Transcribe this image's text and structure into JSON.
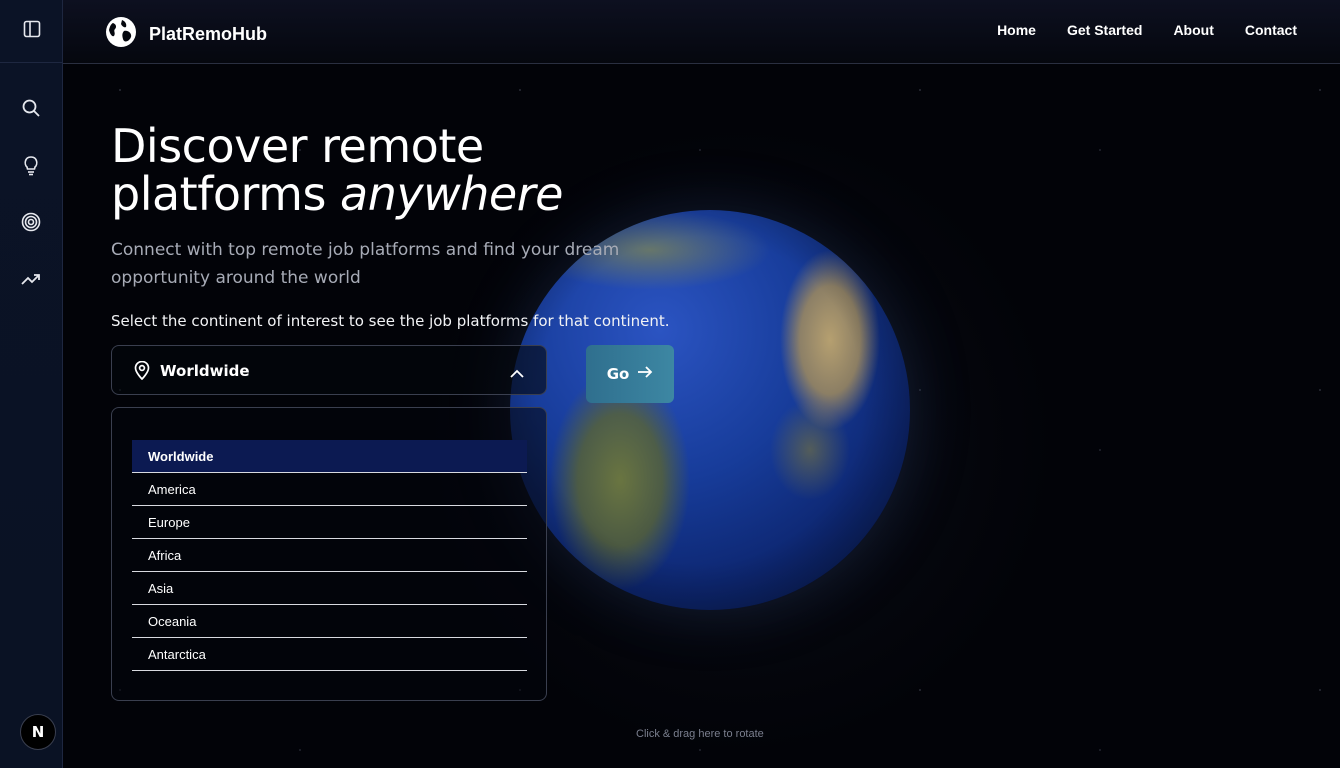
{
  "header": {
    "brand": "PlatRemoHub",
    "nav": [
      "Home",
      "Get Started",
      "About",
      "Contact"
    ]
  },
  "sidebar": {
    "icons": [
      "panel-toggle-icon",
      "search-icon",
      "lightbulb-icon",
      "target-icon",
      "trending-up-icon"
    ],
    "avatar_letter": "N"
  },
  "hero": {
    "title_line1": "Discover remote",
    "title_line2_plain": "platforms",
    "title_line2_italic": "anywhere",
    "subtitle": "Connect with top remote job platforms and find your dream opportunity around the world",
    "instruction": "Select the continent of interest to see the job platforms for that continent."
  },
  "selector": {
    "selected": "Worldwide",
    "go_label": "Go",
    "options": [
      "Worldwide",
      "America",
      "Europe",
      "Africa",
      "Asia",
      "Oceania",
      "Antarctica"
    ]
  },
  "globe": {
    "hint": "Click & drag here to rotate"
  },
  "colors": {
    "background": "#020308",
    "sidebar": "#0b1326",
    "go_button": "#3d87a3",
    "selected_option": "#0c1a52"
  }
}
